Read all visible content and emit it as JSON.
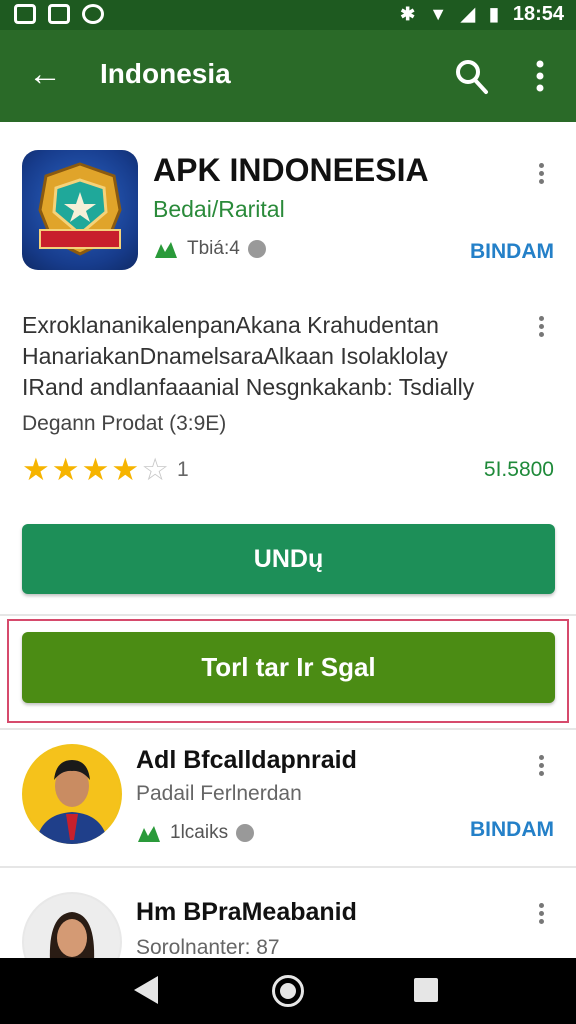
{
  "status_bar": {
    "time": "18:54"
  },
  "app_bar": {
    "title": "Indonesia",
    "back_icon": "arrow-back-icon",
    "search_icon": "search-icon",
    "more_icon": "more-vert-icon"
  },
  "featured_app": {
    "name": "APK INDONEESIA",
    "category": "Bedai/Rarital",
    "meta": "Tbiá:4",
    "badge": "BINDAM",
    "description": [
      "ExroklananikalenpanAkana Krahudentan",
      "HanariakanDnamelsaraAlkaan Isolaklolay",
      "IRand andlanfaaanial Nesgnkakanb: Tsdially"
    ],
    "size_text": "Degann Prodat (3:9E)",
    "rating_value": 4,
    "rating_max": 5,
    "rating_count": "1",
    "price": "5I.5800"
  },
  "buttons": {
    "install_label": "UNDų",
    "secondary_label": "Torl tar Ir Sgal"
  },
  "list_items": [
    {
      "title": "Adl Bfcalldapnraid",
      "subtitle": "Padail Ferlnerdan",
      "meta": "1lcaiks",
      "badge": "BINDAM"
    },
    {
      "title": "Hm BPraMeabanid",
      "subtitle": "Sorolnanter: 87"
    }
  ],
  "colors": {
    "app_bar": "#2a6a28",
    "status_bar": "#1e5a20",
    "primary_button": "#1d8f58",
    "secondary_button": "#4b8c14",
    "highlight": "#d64a6c",
    "accent_blue": "#2480c8",
    "accent_green": "#1f8a3a"
  }
}
